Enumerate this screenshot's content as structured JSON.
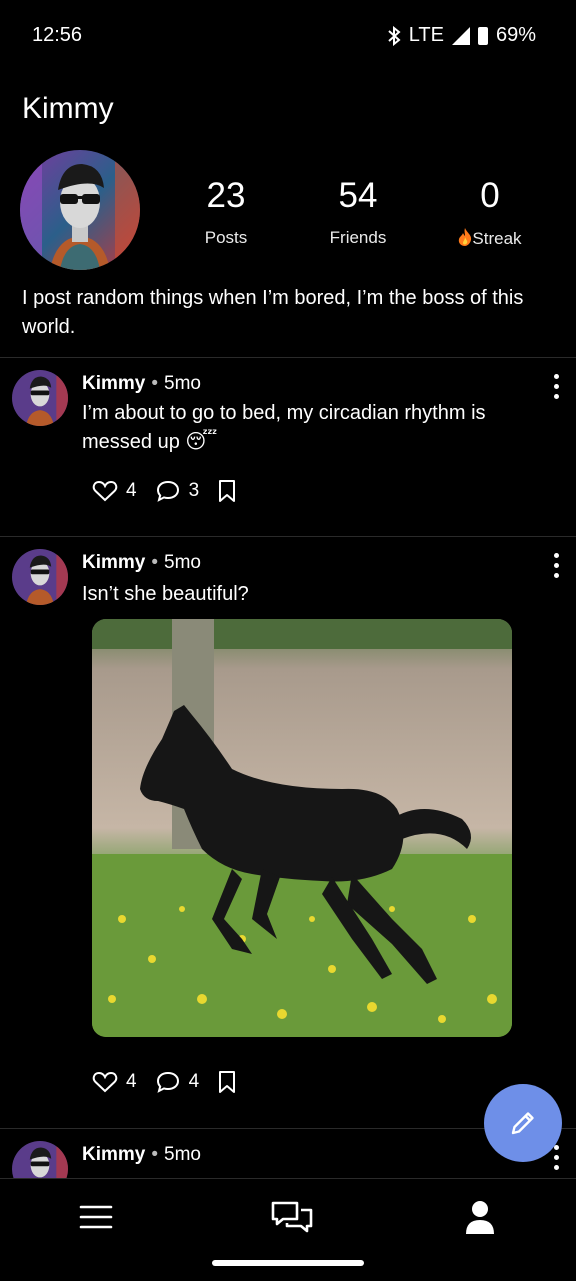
{
  "status_bar": {
    "time": "12:56",
    "network": "LTE",
    "battery": "69%",
    "icons": [
      "bluetooth-icon",
      "signal-icon",
      "battery-icon"
    ]
  },
  "profile": {
    "name": "Kimmy",
    "stats": [
      {
        "value": "23",
        "label": "Posts"
      },
      {
        "value": "54",
        "label": "Friends"
      },
      {
        "value": "0",
        "label": "Streak",
        "icon": "fire-icon"
      }
    ],
    "bio": "I post random things when I’m bored, I’m the boss of this world."
  },
  "posts": [
    {
      "author": "Kimmy",
      "age": "5mo",
      "text": "I’m about to go to bed, my circadian rhythm is messed up 😴",
      "likes": "4",
      "comments": "3"
    },
    {
      "author": "Kimmy",
      "age": "5mo",
      "text": "Isn’t she beautiful?",
      "likes": "4",
      "comments": "4",
      "image_icon": "horse-photo"
    },
    {
      "author": "Kimmy",
      "age": "5mo"
    }
  ],
  "separator": "•",
  "fab_icon": "pencil-icon",
  "nav": [
    "menu-icon",
    "chat-icon",
    "profile-icon"
  ],
  "colors": {
    "accent": "#6e8fe8",
    "background": "#000000",
    "streak": "#ff7a1a"
  }
}
